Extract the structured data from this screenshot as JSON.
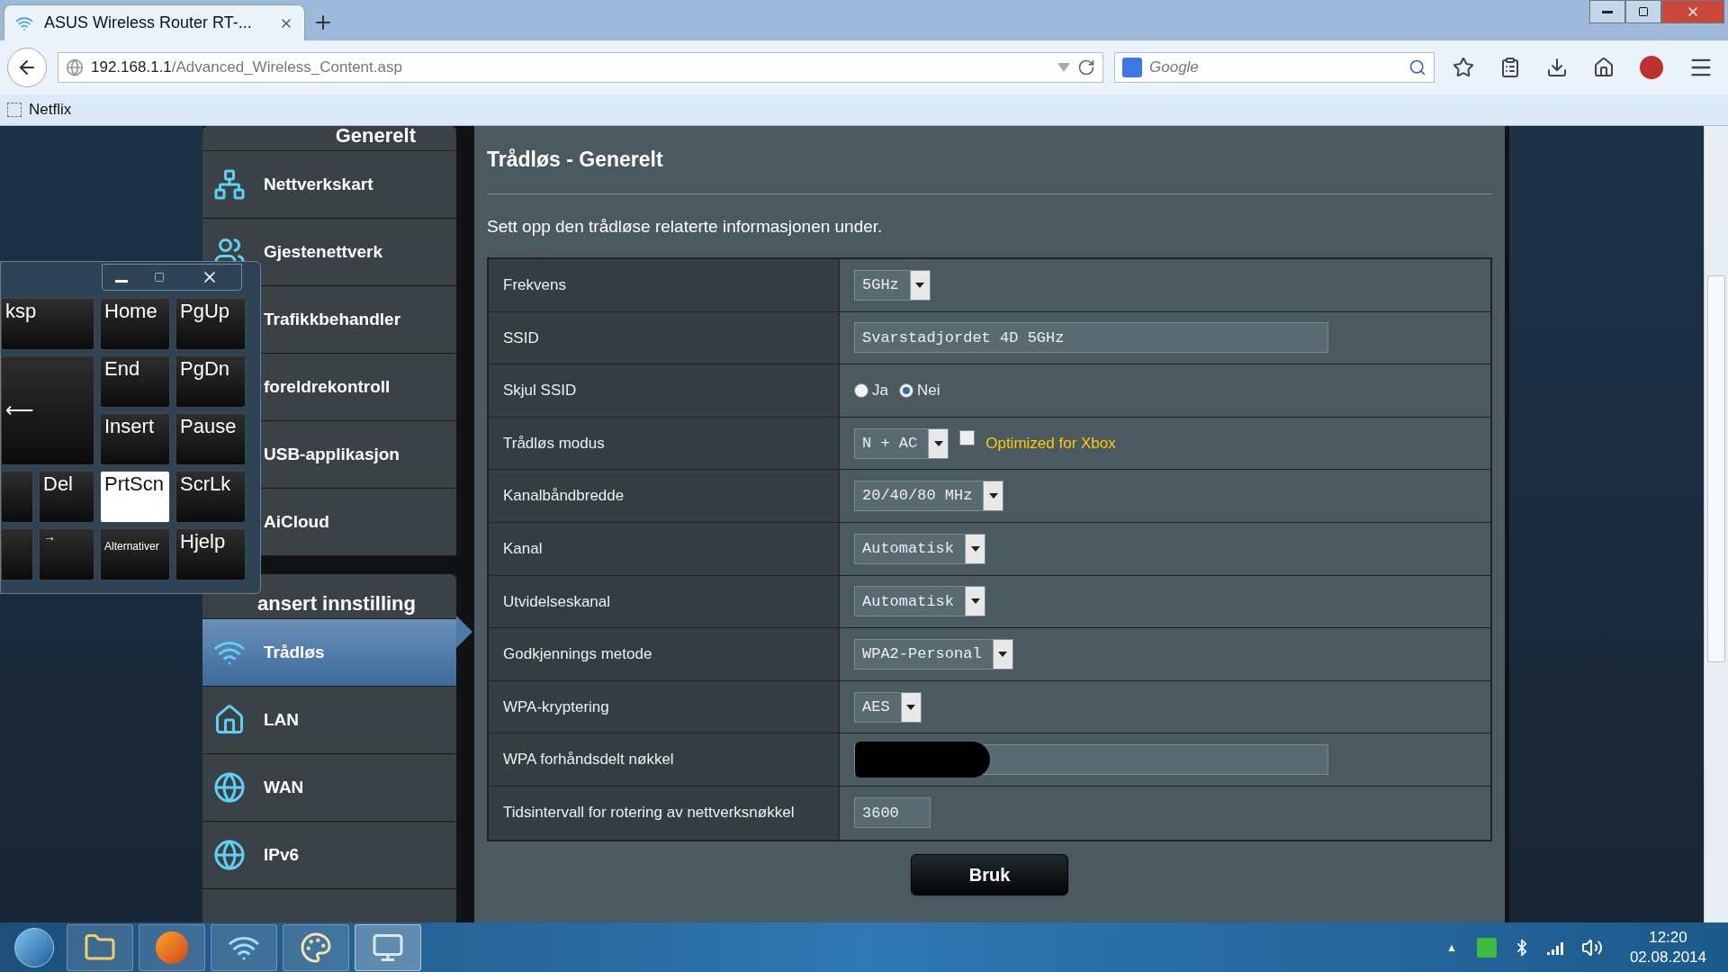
{
  "browser": {
    "tab_title": "ASUS Wireless Router RT-...",
    "url_host": "192.168.1.1",
    "url_path": "/Advanced_Wireless_Content.asp",
    "search_placeholder": "Google",
    "bookmarks": [
      "Netflix"
    ]
  },
  "sidebar": {
    "sections": [
      {
        "title": "Generelt",
        "items": [
          {
            "label": "Nettverkskart",
            "selected": false
          },
          {
            "label": "Gjestenettverk",
            "selected": false
          },
          {
            "label": "Trafikkbehandler",
            "selected": false
          },
          {
            "label": "foreldrekontroll",
            "selected": false
          },
          {
            "label": "USB-applikasjon",
            "selected": false
          },
          {
            "label": "AiCloud",
            "selected": false
          }
        ]
      },
      {
        "title": "ansert innstilling",
        "items": [
          {
            "label": "Trådløs",
            "selected": true
          },
          {
            "label": "LAN",
            "selected": false
          },
          {
            "label": "WAN",
            "selected": false
          },
          {
            "label": "IPv6",
            "selected": false
          },
          {
            "selected": false
          }
        ]
      }
    ]
  },
  "keyboard": {
    "keys": [
      {
        "label": "ksp",
        "pressed": false
      },
      {
        "label": "Home",
        "pressed": false
      },
      {
        "label": "PgUp",
        "pressed": false
      },
      {
        "label": "⟵",
        "pressed": false
      },
      {
        "label": "End",
        "pressed": false
      },
      {
        "label": "PgDn",
        "pressed": false
      },
      {
        "label": "Insert",
        "pressed": false
      },
      {
        "label": "Pause",
        "pressed": false
      },
      {
        "pressed": false
      },
      {
        "label": "Del",
        "pressed": false
      },
      {
        "label": "PrtScn",
        "pressed": true
      },
      {
        "label": "ScrLk",
        "pressed": false
      },
      {
        "pressed": false
      },
      {
        "label": "→",
        "pressed": false
      },
      {
        "label": "Alternativer",
        "pressed": false
      },
      {
        "label": "Hjelp",
        "pressed": false
      }
    ]
  },
  "page": {
    "title": "Trådløs - Generelt",
    "description": "Sett opp den trådløse relaterte informasjonen under.",
    "rows": [
      {
        "label": "Frekvens",
        "kind": "select",
        "value": "5GHz"
      },
      {
        "label": "SSID",
        "kind": "text",
        "value": "Svarstadjordet 4D 5GHz"
      },
      {
        "label": "Skjul SSID",
        "kind": "radio",
        "options": [
          {
            "label": "Ja",
            "selected": false
          },
          {
            "label": "Nei",
            "selected": true
          }
        ]
      },
      {
        "label": "Trådløs modus",
        "kind": "select_checkbox",
        "value": "N + AC",
        "checkbox": {
          "label": "Optimized for Xbox",
          "checked": false
        }
      },
      {
        "label": "Kanalbåndbredde",
        "kind": "select",
        "value": "20/40/80 MHz"
      },
      {
        "label": "Kanal",
        "kind": "select",
        "value": "Automatisk"
      },
      {
        "label": "Utvidelseskanal",
        "kind": "select",
        "value": "Automatisk"
      },
      {
        "label": "Godkjennings metode",
        "kind": "select",
        "value": "WPA2-Personal"
      },
      {
        "label": "WPA-kryptering",
        "kind": "select",
        "value": "AES"
      },
      {
        "label": "WPA forhåndsdelt nøkkel",
        "kind": "redacted"
      },
      {
        "label": "Tidsintervall for rotering av nettverksnøkkel",
        "kind": "short_text",
        "value": "3600"
      }
    ],
    "apply_button": "Bruk"
  },
  "taskbar": {
    "tray_arrow": "▲",
    "time": "12:20",
    "date": "02.08.2014"
  }
}
